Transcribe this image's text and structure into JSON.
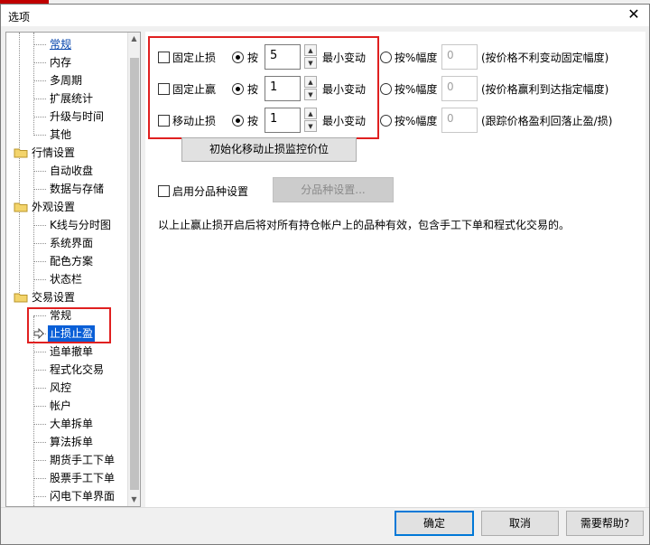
{
  "window": {
    "title": "选项",
    "close_glyph": "✕"
  },
  "tree": {
    "items": [
      {
        "label": "常规",
        "level": 1,
        "link": true
      },
      {
        "label": "内存",
        "level": 1
      },
      {
        "label": "多周期",
        "level": 1
      },
      {
        "label": "扩展统计",
        "level": 1
      },
      {
        "label": "升级与时间",
        "level": 1
      },
      {
        "label": "其他",
        "level": 1
      },
      {
        "label": "行情设置",
        "level": 0,
        "folder": true
      },
      {
        "label": "自动收盘",
        "level": 1
      },
      {
        "label": "数据与存储",
        "level": 1
      },
      {
        "label": "外观设置",
        "level": 0,
        "folder": true
      },
      {
        "label": "K线与分时图",
        "level": 1
      },
      {
        "label": "系统界面",
        "level": 1
      },
      {
        "label": "配色方案",
        "level": 1
      },
      {
        "label": "状态栏",
        "level": 1
      },
      {
        "label": "交易设置",
        "level": 0,
        "folder": true
      },
      {
        "label": "常规",
        "level": 1
      },
      {
        "label": "止损止盈",
        "level": 1,
        "selected": true
      },
      {
        "label": "追单撤单",
        "level": 1
      },
      {
        "label": "程式化交易",
        "level": 1
      },
      {
        "label": "风控",
        "level": 1
      },
      {
        "label": "帐户",
        "level": 1
      },
      {
        "label": "大单拆单",
        "level": 1
      },
      {
        "label": "算法拆单",
        "level": 1
      },
      {
        "label": "期货手工下单",
        "level": 1
      },
      {
        "label": "股票手工下单",
        "level": 1
      },
      {
        "label": "闪电下单界面",
        "level": 1
      }
    ]
  },
  "stop_rows": [
    {
      "checkbox_label": "固定止损",
      "radio1_label": "按",
      "value": "5",
      "min_change_label": "最小变动",
      "radio2_label": "按%幅度",
      "percent_value": "0",
      "hint": "(按价格不利变动固定幅度)"
    },
    {
      "checkbox_label": "固定止赢",
      "radio1_label": "按",
      "value": "1",
      "min_change_label": "最小变动",
      "radio2_label": "按%幅度",
      "percent_value": "0",
      "hint": "(按价格赢利到达指定幅度)"
    },
    {
      "checkbox_label": "移动止损",
      "radio1_label": "按",
      "value": "1",
      "min_change_label": "最小变动",
      "radio2_label": "按%幅度",
      "percent_value": "0",
      "hint": "(跟踪价格盈利回落止盈/损)"
    }
  ],
  "init_button": "初始化移动止损监控价位",
  "per_variety": {
    "checkbox_label": "启用分品种设置",
    "button": "分品种设置..."
  },
  "note": "以上止赢止损开启后将对所有持仓帐户上的品种有效，包含手工下单和程式化交易的。",
  "footer": {
    "ok": "确定",
    "cancel": "取消",
    "help": "需要帮助?"
  },
  "colors": {
    "highlight_box": "#e02020",
    "selection": "#0a5fd7",
    "link": "#0645ad"
  }
}
